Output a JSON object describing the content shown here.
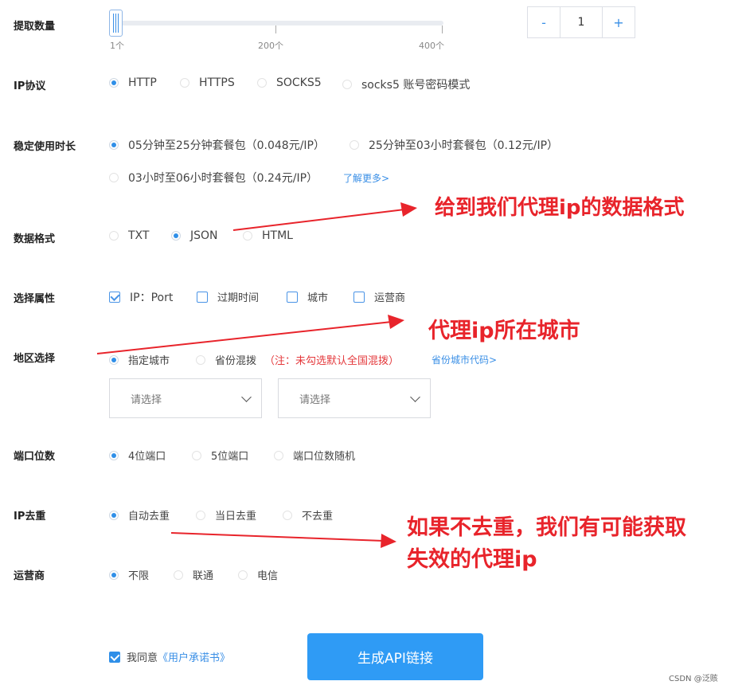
{
  "rows": {
    "quantity": "提取数量",
    "protocol": "IP协议",
    "duration": "稳定使用时长",
    "format": "数据格式",
    "attributes": "选择属性",
    "region": "地区选择",
    "port": "端口位数",
    "dedup": "IP去重",
    "carrier": "运营商"
  },
  "slider": {
    "ticks": [
      "1个",
      "200个",
      "400个"
    ],
    "value": 1,
    "min": 1,
    "max": 400
  },
  "stepper": {
    "minus": "-",
    "value": "1",
    "plus": "+"
  },
  "protocol_options": [
    "HTTP",
    "HTTPS",
    "SOCKS5",
    "socks5 账号密码模式"
  ],
  "duration_options": [
    "05分钟至25分钟套餐包（0.048元/IP）",
    "25分钟至03小时套餐包（0.12元/IP）",
    "03小时至06小时套餐包（0.24元/IP）"
  ],
  "duration_link": "了解更多>",
  "format_options": [
    "TXT",
    "JSON",
    "HTML"
  ],
  "attribute_options": [
    "IP：Port",
    "过期时间",
    "城市",
    "运营商"
  ],
  "region_options": [
    "指定城市",
    "省份混拨"
  ],
  "region_note": "（注：未勾选默认全国混拨）",
  "region_link": "省份城市代码>",
  "selects": [
    "请选择",
    "请选择"
  ],
  "port_options": [
    "4位端口",
    "5位端口",
    "端口位数随机"
  ],
  "dedup_options": [
    "自动去重",
    "当日去重",
    "不去重"
  ],
  "carrier_options": [
    "不限",
    "联通",
    "电信"
  ],
  "agree": {
    "text": "我同意",
    "link": "《用户承诺书》"
  },
  "generate_button": "生成API链接",
  "annotations": {
    "format": "给到我们代理ip的数据格式",
    "city": "代理ip所在城市",
    "dedup_line1": "如果不去重，我们有可能获取",
    "dedup_line2": "失效的代理ip"
  },
  "footer": "CSDN @泛赅",
  "colors": {
    "accent": "#2f8fe8",
    "button": "#2f9bf5",
    "annotation": "#e8242b"
  }
}
